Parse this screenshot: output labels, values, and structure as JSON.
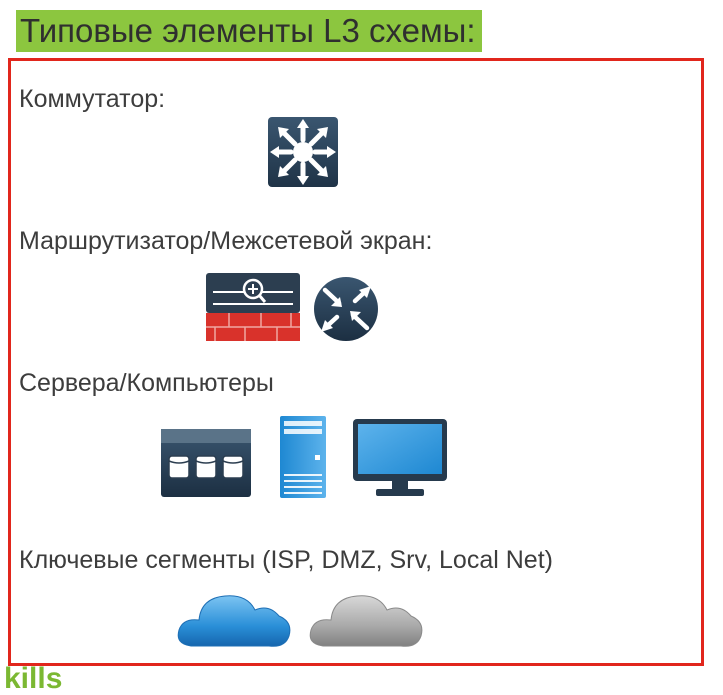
{
  "slide": {
    "title": "Типовые элементы L3 схемы:",
    "sections": [
      {
        "label": "Коммутатор:"
      },
      {
        "label": "Маршрутизатор/Межсетевой экран:"
      },
      {
        "label": "Сервера/Компьютеры"
      },
      {
        "label": "Ключевые сегменты (ISP, DMZ, Srv, Local Net)"
      }
    ],
    "brand_fragment": "kills"
  },
  "colors": {
    "title_bg": "#8cc63f",
    "frame_border": "#e1261c",
    "icon_dark": "#2c3e50",
    "icon_blue": "#1e88d2",
    "firewall_red": "#d9322b"
  },
  "icons": [
    "switch-icon",
    "firewall-icon",
    "router-icon",
    "storage-array-icon",
    "server-tower-icon",
    "monitor-icon",
    "blue-cloud-icon",
    "gray-cloud-icon"
  ]
}
